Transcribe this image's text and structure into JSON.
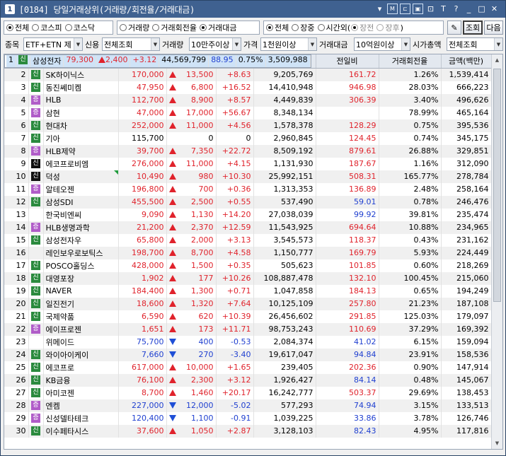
{
  "window": {
    "number": "1",
    "title": "[0184] 당일거래상위(거래량/회전율/거래대금)"
  },
  "toolbar_icons": [
    "dropdown-icon",
    "memo-icon",
    "link-icon",
    "popup-icon",
    "lock-icon",
    "font-icon",
    "help-icon",
    "minimize-icon",
    "maximize-icon",
    "close-icon"
  ],
  "market_radios": [
    {
      "label": "전체",
      "checked": true
    },
    {
      "label": "코스피",
      "checked": false
    },
    {
      "label": "코스닥",
      "checked": false
    }
  ],
  "sort_radios": [
    {
      "label": "거래량",
      "checked": false
    },
    {
      "label": "거래회전율",
      "checked": false
    },
    {
      "label": "거래대금",
      "checked": true
    }
  ],
  "session_radios": [
    {
      "label": "전체",
      "checked": true
    },
    {
      "label": "장중",
      "checked": false
    },
    {
      "label": "시간외(",
      "checked": false
    }
  ],
  "afterhours_radios": [
    {
      "label": "장전",
      "checked": true
    },
    {
      "label": "장후",
      "checked": false
    }
  ],
  "afterhours_close": ")",
  "buttons": {
    "query": "조회",
    "next": "다음"
  },
  "filters": {
    "stock_label": "종목",
    "stock_value": "ETF+ETN 제",
    "credit_label": "신용",
    "credit_value": "전체조회",
    "volume_label": "거래량",
    "volume_value": "10만주이상",
    "price_label": "가격",
    "price_value": "1천원이상",
    "amount_label": "거래대금",
    "amount_value": "10억원이상",
    "cap_label": "시가총액",
    "cap_value": "전체조회"
  },
  "columns": [
    "순위",
    "분",
    "종목명",
    "현재가",
    "전일대비",
    "등락률",
    "거래량",
    "전일비",
    "거래회전율",
    "금액(백만)"
  ],
  "rows": [
    {
      "rank": "1",
      "mark": "신",
      "name": "삼성전자",
      "price": "79,300",
      "dir": "up",
      "change": "2,400",
      "rate": "+3.12",
      "volume": "44,569,799",
      "prev": "88.95",
      "prev_color": "blue",
      "turnover": "0.75%",
      "amount": "3,509,988"
    },
    {
      "rank": "2",
      "mark": "신",
      "name": "SK하이닉스",
      "price": "170,000",
      "dir": "up",
      "change": "13,500",
      "rate": "+8.63",
      "volume": "9,205,769",
      "prev": "161.72",
      "prev_color": "red",
      "turnover": "1.26%",
      "amount": "1,539,414"
    },
    {
      "rank": "3",
      "mark": "신",
      "name": "동진쎄미켐",
      "price": "47,950",
      "dir": "up",
      "change": "6,800",
      "rate": "+16.52",
      "volume": "14,410,948",
      "prev": "946.98",
      "prev_color": "red",
      "turnover": "28.03%",
      "amount": "666,223"
    },
    {
      "rank": "4",
      "mark": "증",
      "name": "HLB",
      "price": "112,700",
      "dir": "up",
      "change": "8,900",
      "rate": "+8.57",
      "volume": "4,449,839",
      "prev": "306.39",
      "prev_color": "red",
      "turnover": "3.40%",
      "amount": "496,626"
    },
    {
      "rank": "5",
      "mark": "증",
      "name": "삼현",
      "price": "47,000",
      "dir": "up",
      "change": "17,000",
      "rate": "+56.67",
      "volume": "8,348,134",
      "prev": "",
      "prev_color": "red",
      "turnover": "78.99%",
      "amount": "465,164"
    },
    {
      "rank": "6",
      "mark": "신",
      "name": "현대차",
      "price": "252,000",
      "dir": "up",
      "change": "11,000",
      "rate": "+4.56",
      "volume": "1,578,378",
      "prev": "128.29",
      "prev_color": "red",
      "turnover": "0.75%",
      "amount": "395,536"
    },
    {
      "rank": "7",
      "mark": "신",
      "name": "기아",
      "price": "115,700",
      "dir": "none",
      "change": "0",
      "rate": "0",
      "volume": "2,960,845",
      "prev": "124.45",
      "prev_color": "red",
      "turnover": "0.74%",
      "amount": "345,175"
    },
    {
      "rank": "8",
      "mark": "증",
      "name": "HLB제약",
      "price": "39,700",
      "dir": "up",
      "change": "7,350",
      "rate": "+22.72",
      "volume": "8,509,192",
      "prev": "879.61",
      "prev_color": "red",
      "turnover": "26.88%",
      "amount": "329,851"
    },
    {
      "rank": "9",
      "mark": "신",
      "name": "에코프로비엠",
      "price": "276,000",
      "dir": "up",
      "change": "11,000",
      "rate": "+4.15",
      "volume": "1,131,930",
      "prev": "187.67",
      "prev_color": "red",
      "turnover": "1.16%",
      "amount": "312,090"
    },
    {
      "rank": "10",
      "mark": "신",
      "name": "덕성",
      "price": "10,490",
      "dir": "up",
      "change": "980",
      "rate": "+10.30",
      "volume": "25,992,151",
      "prev": "508.31",
      "prev_color": "red",
      "turnover": "165.77%",
      "amount": "278,784"
    },
    {
      "rank": "11",
      "mark": "증",
      "name": "알테오젠",
      "price": "196,800",
      "dir": "up",
      "change": "700",
      "rate": "+0.36",
      "volume": "1,313,353",
      "prev": "136.89",
      "prev_color": "red",
      "turnover": "2.48%",
      "amount": "258,164"
    },
    {
      "rank": "12",
      "mark": "신",
      "name": "삼성SDI",
      "price": "455,500",
      "dir": "up",
      "change": "2,500",
      "rate": "+0.55",
      "volume": "537,490",
      "prev": "59.01",
      "prev_color": "blue",
      "turnover": "0.78%",
      "amount": "246,476"
    },
    {
      "rank": "13",
      "mark": "",
      "name": "한국비엔씨",
      "price": "9,090",
      "dir": "up",
      "change": "1,130",
      "rate": "+14.20",
      "volume": "27,038,039",
      "prev": "99.92",
      "prev_color": "blue",
      "turnover": "39.81%",
      "amount": "235,474"
    },
    {
      "rank": "14",
      "mark": "증",
      "name": "HLB생명과학",
      "price": "21,200",
      "dir": "up",
      "change": "2,370",
      "rate": "+12.59",
      "volume": "11,543,925",
      "prev": "694.64",
      "prev_color": "red",
      "turnover": "10.88%",
      "amount": "234,965"
    },
    {
      "rank": "15",
      "mark": "신",
      "name": "삼성전자우",
      "price": "65,800",
      "dir": "up",
      "change": "2,000",
      "rate": "+3.13",
      "volume": "3,545,573",
      "prev": "118.37",
      "prev_color": "red",
      "turnover": "0.43%",
      "amount": "231,162"
    },
    {
      "rank": "16",
      "mark": "",
      "name": "레인보우로보틱스",
      "price": "198,700",
      "dir": "up",
      "change": "8,700",
      "rate": "+4.58",
      "volume": "1,150,777",
      "prev": "169.79",
      "prev_color": "red",
      "turnover": "5.93%",
      "amount": "224,449"
    },
    {
      "rank": "17",
      "mark": "신",
      "name": "POSCO홀딩스",
      "price": "428,000",
      "dir": "up",
      "change": "1,500",
      "rate": "+0.35",
      "volume": "505,623",
      "prev": "101.85",
      "prev_color": "red",
      "turnover": "0.60%",
      "amount": "218,269"
    },
    {
      "rank": "18",
      "mark": "신",
      "name": "대영포장",
      "price": "1,902",
      "dir": "up",
      "change": "177",
      "rate": "+10.26",
      "volume": "108,887,478",
      "prev": "132.10",
      "prev_color": "red",
      "turnover": "100.45%",
      "amount": "215,060"
    },
    {
      "rank": "19",
      "mark": "신",
      "name": "NAVER",
      "price": "184,400",
      "dir": "up",
      "change": "1,300",
      "rate": "+0.71",
      "volume": "1,047,858",
      "prev": "184.13",
      "prev_color": "red",
      "turnover": "0.65%",
      "amount": "194,249"
    },
    {
      "rank": "20",
      "mark": "신",
      "name": "일진전기",
      "price": "18,600",
      "dir": "up",
      "change": "1,320",
      "rate": "+7.64",
      "volume": "10,125,109",
      "prev": "257.80",
      "prev_color": "red",
      "turnover": "21.23%",
      "amount": "187,108"
    },
    {
      "rank": "21",
      "mark": "신",
      "name": "국제약품",
      "price": "6,590",
      "dir": "up",
      "change": "620",
      "rate": "+10.39",
      "volume": "26,456,602",
      "prev": "291.85",
      "prev_color": "red",
      "turnover": "125.03%",
      "amount": "179,097"
    },
    {
      "rank": "22",
      "mark": "증",
      "name": "에이프로젠",
      "price": "1,651",
      "dir": "up",
      "change": "173",
      "rate": "+11.71",
      "volume": "98,753,243",
      "prev": "110.69",
      "prev_color": "red",
      "turnover": "37.29%",
      "amount": "169,392"
    },
    {
      "rank": "23",
      "mark": "",
      "name": "위메이드",
      "price": "75,700",
      "dir": "down",
      "change": "400",
      "rate": "-0.53",
      "volume": "2,084,374",
      "prev": "41.02",
      "prev_color": "blue",
      "turnover": "6.15%",
      "amount": "159,094"
    },
    {
      "rank": "24",
      "mark": "신",
      "name": "와이아이케이",
      "price": "7,660",
      "dir": "down",
      "change": "270",
      "rate": "-3.40",
      "volume": "19,617,047",
      "prev": "94.84",
      "prev_color": "blue",
      "turnover": "23.91%",
      "amount": "158,536"
    },
    {
      "rank": "25",
      "mark": "신",
      "name": "에코프로",
      "price": "617,000",
      "dir": "up",
      "change": "10,000",
      "rate": "+1.65",
      "volume": "239,405",
      "prev": "202.36",
      "prev_color": "red",
      "turnover": "0.90%",
      "amount": "147,914"
    },
    {
      "rank": "26",
      "mark": "신",
      "name": "KB금융",
      "price": "76,100",
      "dir": "up",
      "change": "2,300",
      "rate": "+3.12",
      "volume": "1,926,427",
      "prev": "84.14",
      "prev_color": "blue",
      "turnover": "0.48%",
      "amount": "145,067"
    },
    {
      "rank": "27",
      "mark": "신",
      "name": "아미코젠",
      "price": "8,700",
      "dir": "up",
      "change": "1,460",
      "rate": "+20.17",
      "volume": "16,242,777",
      "prev": "503.37",
      "prev_color": "red",
      "turnover": "29.69%",
      "amount": "138,453"
    },
    {
      "rank": "28",
      "mark": "증",
      "name": "엔켐",
      "price": "227,000",
      "dir": "down",
      "change": "12,000",
      "rate": "-5.02",
      "volume": "577,293",
      "prev": "74.94",
      "prev_color": "blue",
      "turnover": "3.15%",
      "amount": "133,513"
    },
    {
      "rank": "29",
      "mark": "증",
      "name": "신성델타테크",
      "price": "120,400",
      "dir": "down",
      "change": "1,100",
      "rate": "-0.91",
      "volume": "1,039,225",
      "prev": "33.86",
      "prev_color": "blue",
      "turnover": "3.78%",
      "amount": "126,746"
    },
    {
      "rank": "30",
      "mark": "신",
      "name": "이수페타시스",
      "price": "37,600",
      "dir": "up",
      "change": "1,050",
      "rate": "+2.87",
      "volume": "3,128,103",
      "prev": "82.43",
      "prev_color": "blue",
      "turnover": "4.95%",
      "amount": "117,816"
    }
  ],
  "colors": {
    "up": "#e0232c",
    "down": "#1f3fd0",
    "titlebar": "#3f6190",
    "selected_row": "#cfe3f7"
  }
}
